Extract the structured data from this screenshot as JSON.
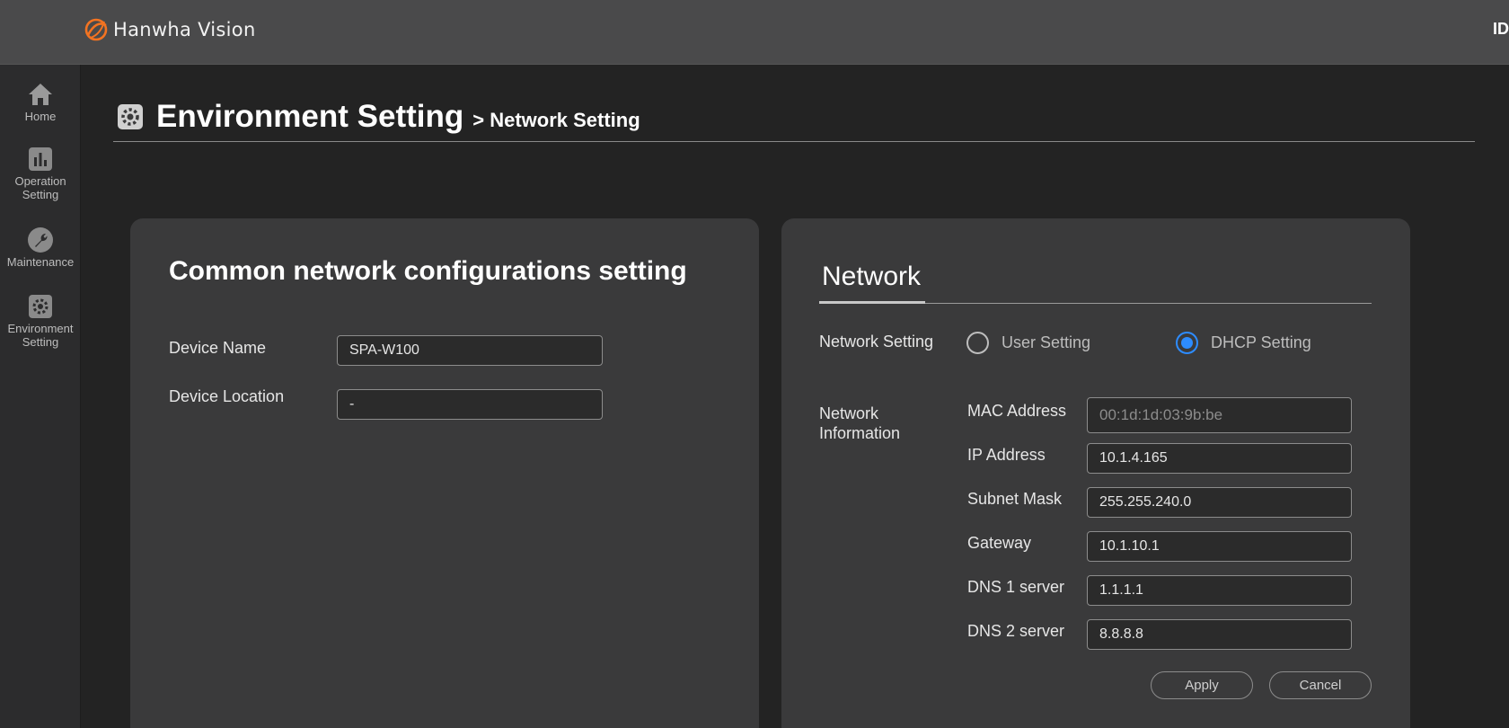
{
  "header": {
    "brand": "Hanwha Vision",
    "user_id": "ID"
  },
  "sidebar": {
    "items": [
      {
        "label": "Home",
        "icon": "home-icon"
      },
      {
        "label": "Operation Setting",
        "icon": "chart-icon"
      },
      {
        "label": "Maintenance",
        "icon": "wrench-icon"
      },
      {
        "label": "Environment Setting",
        "icon": "gear-icon"
      }
    ]
  },
  "page": {
    "title": "Environment Setting",
    "subtitle": "> Network Setting"
  },
  "common": {
    "heading": "Common network configurations setting",
    "device_name_label": "Device Name",
    "device_name_value": "SPA-W100",
    "device_location_label": "Device Location",
    "device_location_value": "-"
  },
  "network": {
    "tab_label": "Network",
    "setting_label": "Network Setting",
    "radio_user": "User Setting",
    "radio_dhcp": "DHCP Setting",
    "selected": "DHCP Setting",
    "info_label": "Network Information",
    "fields": [
      {
        "label": "MAC Address",
        "value": "00:1d:1d:03:9b:be"
      },
      {
        "label": "IP Address",
        "value": "10.1.4.165"
      },
      {
        "label": "Subnet Mask",
        "value": "255.255.240.0"
      },
      {
        "label": "Gateway",
        "value": "10.1.10.1"
      },
      {
        "label": "DNS 1 server",
        "value": "1.1.1.1"
      },
      {
        "label": "DNS 2 server",
        "value": "8.8.8.8"
      }
    ],
    "apply_label": "Apply",
    "cancel_label": "Cancel"
  },
  "colors": {
    "accent": "#2d8cff",
    "logo_orange": "#f37321",
    "panel": "#3a3a3b",
    "topbar": "#4a4a4b"
  }
}
